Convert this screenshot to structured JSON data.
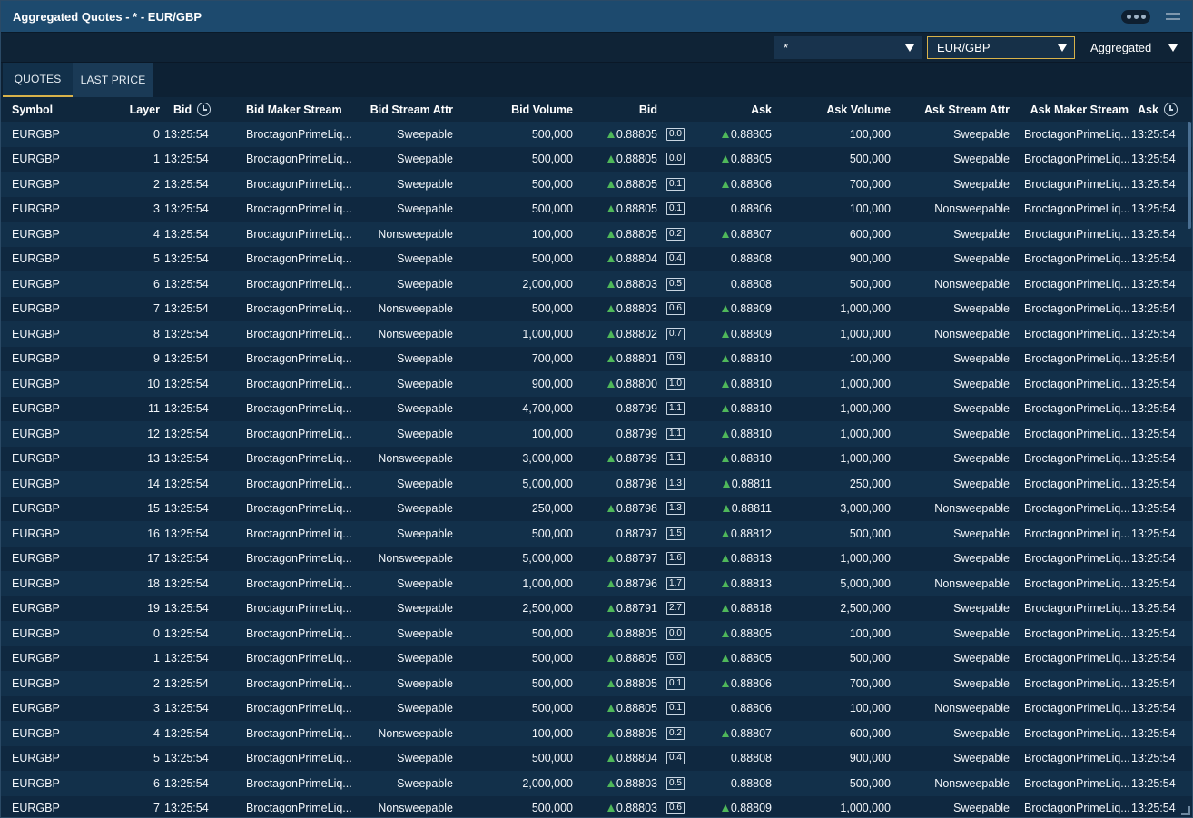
{
  "window": {
    "title": "Aggregated Quotes - * - EUR/GBP",
    "more_icon": "more-dots-icon",
    "menu_icon": "hamburger-icon"
  },
  "toolbar": {
    "filter_value": "*",
    "pair_value": "EUR/GBP",
    "mode_value": "Aggregated",
    "accent_color": "#d8b24a"
  },
  "tabs": [
    {
      "label": "QUOTES",
      "active": true
    },
    {
      "label": "LAST PRICE",
      "active": false
    }
  ],
  "columns": {
    "symbol": "Symbol",
    "layer": "Layer",
    "bid_time": "Bid",
    "bid_maker_stream": "Bid Maker Stream",
    "bid_stream_attr": "Bid Stream Attr",
    "bid_volume": "Bid Volume",
    "bid": "Bid",
    "ask": "Ask",
    "ask_volume": "Ask Volume",
    "ask_stream_attr": "Ask Stream Attr",
    "ask_maker_stream": "Ask Maker Stream",
    "ask_time": "Ask"
  },
  "up_color": "#4fb85a",
  "rows": [
    {
      "sym": "EURGBP",
      "layer": "0",
      "bt": "13:25:54",
      "bms": "BroctagonPrimeLiq...",
      "bsa": "Sweepable",
      "bvol": "500,000",
      "bid": "0.88805",
      "bup": true,
      "spr": "0.0",
      "ask": "0.88805",
      "aup": true,
      "avol": "100,000",
      "asa": "Sweepable",
      "ams": "BroctagonPrimeLiq...",
      "at": "13:25:54"
    },
    {
      "sym": "EURGBP",
      "layer": "1",
      "bt": "13:25:54",
      "bms": "BroctagonPrimeLiq...",
      "bsa": "Sweepable",
      "bvol": "500,000",
      "bid": "0.88805",
      "bup": true,
      "spr": "0.0",
      "ask": "0.88805",
      "aup": true,
      "avol": "500,000",
      "asa": "Sweepable",
      "ams": "BroctagonPrimeLiq...",
      "at": "13:25:54"
    },
    {
      "sym": "EURGBP",
      "layer": "2",
      "bt": "13:25:54",
      "bms": "BroctagonPrimeLiq...",
      "bsa": "Sweepable",
      "bvol": "500,000",
      "bid": "0.88805",
      "bup": true,
      "spr": "0.1",
      "ask": "0.88806",
      "aup": true,
      "avol": "700,000",
      "asa": "Sweepable",
      "ams": "BroctagonPrimeLiq...",
      "at": "13:25:54"
    },
    {
      "sym": "EURGBP",
      "layer": "3",
      "bt": "13:25:54",
      "bms": "BroctagonPrimeLiq...",
      "bsa": "Sweepable",
      "bvol": "500,000",
      "bid": "0.88805",
      "bup": true,
      "spr": "0.1",
      "ask": "0.88806",
      "aup": false,
      "avol": "100,000",
      "asa": "Nonsweepable",
      "ams": "BroctagonPrimeLiq...",
      "at": "13:25:54"
    },
    {
      "sym": "EURGBP",
      "layer": "4",
      "bt": "13:25:54",
      "bms": "BroctagonPrimeLiq...",
      "bsa": "Nonsweepable",
      "bvol": "100,000",
      "bid": "0.88805",
      "bup": true,
      "spr": "0.2",
      "ask": "0.88807",
      "aup": true,
      "avol": "600,000",
      "asa": "Sweepable",
      "ams": "BroctagonPrimeLiq...",
      "at": "13:25:54"
    },
    {
      "sym": "EURGBP",
      "layer": "5",
      "bt": "13:25:54",
      "bms": "BroctagonPrimeLiq...",
      "bsa": "Sweepable",
      "bvol": "500,000",
      "bid": "0.88804",
      "bup": true,
      "spr": "0.4",
      "ask": "0.88808",
      "aup": false,
      "avol": "900,000",
      "asa": "Sweepable",
      "ams": "BroctagonPrimeLiq...",
      "at": "13:25:54"
    },
    {
      "sym": "EURGBP",
      "layer": "6",
      "bt": "13:25:54",
      "bms": "BroctagonPrimeLiq...",
      "bsa": "Sweepable",
      "bvol": "2,000,000",
      "bid": "0.88803",
      "bup": true,
      "spr": "0.5",
      "ask": "0.88808",
      "aup": false,
      "avol": "500,000",
      "asa": "Nonsweepable",
      "ams": "BroctagonPrimeLiq...",
      "at": "13:25:54"
    },
    {
      "sym": "EURGBP",
      "layer": "7",
      "bt": "13:25:54",
      "bms": "BroctagonPrimeLiq...",
      "bsa": "Nonsweepable",
      "bvol": "500,000",
      "bid": "0.88803",
      "bup": true,
      "spr": "0.6",
      "ask": "0.88809",
      "aup": true,
      "avol": "1,000,000",
      "asa": "Sweepable",
      "ams": "BroctagonPrimeLiq...",
      "at": "13:25:54"
    },
    {
      "sym": "EURGBP",
      "layer": "8",
      "bt": "13:25:54",
      "bms": "BroctagonPrimeLiq...",
      "bsa": "Nonsweepable",
      "bvol": "1,000,000",
      "bid": "0.88802",
      "bup": true,
      "spr": "0.7",
      "ask": "0.88809",
      "aup": true,
      "avol": "1,000,000",
      "asa": "Nonsweepable",
      "ams": "BroctagonPrimeLiq...",
      "at": "13:25:54"
    },
    {
      "sym": "EURGBP",
      "layer": "9",
      "bt": "13:25:54",
      "bms": "BroctagonPrimeLiq...",
      "bsa": "Sweepable",
      "bvol": "700,000",
      "bid": "0.88801",
      "bup": true,
      "spr": "0.9",
      "ask": "0.88810",
      "aup": true,
      "avol": "100,000",
      "asa": "Sweepable",
      "ams": "BroctagonPrimeLiq...",
      "at": "13:25:54"
    },
    {
      "sym": "EURGBP",
      "layer": "10",
      "bt": "13:25:54",
      "bms": "BroctagonPrimeLiq...",
      "bsa": "Sweepable",
      "bvol": "900,000",
      "bid": "0.88800",
      "bup": true,
      "spr": "1.0",
      "ask": "0.88810",
      "aup": true,
      "avol": "1,000,000",
      "asa": "Sweepable",
      "ams": "BroctagonPrimeLiq...",
      "at": "13:25:54"
    },
    {
      "sym": "EURGBP",
      "layer": "11",
      "bt": "13:25:54",
      "bms": "BroctagonPrimeLiq...",
      "bsa": "Sweepable",
      "bvol": "4,700,000",
      "bid": "0.88799",
      "bup": false,
      "spr": "1.1",
      "ask": "0.88810",
      "aup": true,
      "avol": "1,000,000",
      "asa": "Sweepable",
      "ams": "BroctagonPrimeLiq...",
      "at": "13:25:54"
    },
    {
      "sym": "EURGBP",
      "layer": "12",
      "bt": "13:25:54",
      "bms": "BroctagonPrimeLiq...",
      "bsa": "Sweepable",
      "bvol": "100,000",
      "bid": "0.88799",
      "bup": false,
      "spr": "1.1",
      "ask": "0.88810",
      "aup": true,
      "avol": "1,000,000",
      "asa": "Sweepable",
      "ams": "BroctagonPrimeLiq...",
      "at": "13:25:54"
    },
    {
      "sym": "EURGBP",
      "layer": "13",
      "bt": "13:25:54",
      "bms": "BroctagonPrimeLiq...",
      "bsa": "Nonsweepable",
      "bvol": "3,000,000",
      "bid": "0.88799",
      "bup": true,
      "spr": "1.1",
      "ask": "0.88810",
      "aup": true,
      "avol": "1,000,000",
      "asa": "Sweepable",
      "ams": "BroctagonPrimeLiq...",
      "at": "13:25:54"
    },
    {
      "sym": "EURGBP",
      "layer": "14",
      "bt": "13:25:54",
      "bms": "BroctagonPrimeLiq...",
      "bsa": "Sweepable",
      "bvol": "5,000,000",
      "bid": "0.88798",
      "bup": false,
      "spr": "1.3",
      "ask": "0.88811",
      "aup": true,
      "avol": "250,000",
      "asa": "Sweepable",
      "ams": "BroctagonPrimeLiq...",
      "at": "13:25:54"
    },
    {
      "sym": "EURGBP",
      "layer": "15",
      "bt": "13:25:54",
      "bms": "BroctagonPrimeLiq...",
      "bsa": "Sweepable",
      "bvol": "250,000",
      "bid": "0.88798",
      "bup": true,
      "spr": "1.3",
      "ask": "0.88811",
      "aup": true,
      "avol": "3,000,000",
      "asa": "Nonsweepable",
      "ams": "BroctagonPrimeLiq...",
      "at": "13:25:54"
    },
    {
      "sym": "EURGBP",
      "layer": "16",
      "bt": "13:25:54",
      "bms": "BroctagonPrimeLiq...",
      "bsa": "Sweepable",
      "bvol": "500,000",
      "bid": "0.88797",
      "bup": false,
      "spr": "1.5",
      "ask": "0.88812",
      "aup": true,
      "avol": "500,000",
      "asa": "Sweepable",
      "ams": "BroctagonPrimeLiq...",
      "at": "13:25:54"
    },
    {
      "sym": "EURGBP",
      "layer": "17",
      "bt": "13:25:54",
      "bms": "BroctagonPrimeLiq...",
      "bsa": "Nonsweepable",
      "bvol": "5,000,000",
      "bid": "0.88797",
      "bup": true,
      "spr": "1.6",
      "ask": "0.88813",
      "aup": true,
      "avol": "1,000,000",
      "asa": "Sweepable",
      "ams": "BroctagonPrimeLiq...",
      "at": "13:25:54"
    },
    {
      "sym": "EURGBP",
      "layer": "18",
      "bt": "13:25:54",
      "bms": "BroctagonPrimeLiq...",
      "bsa": "Sweepable",
      "bvol": "1,000,000",
      "bid": "0.88796",
      "bup": true,
      "spr": "1.7",
      "ask": "0.88813",
      "aup": true,
      "avol": "5,000,000",
      "asa": "Nonsweepable",
      "ams": "BroctagonPrimeLiq...",
      "at": "13:25:54"
    },
    {
      "sym": "EURGBP",
      "layer": "19",
      "bt": "13:25:54",
      "bms": "BroctagonPrimeLiq...",
      "bsa": "Sweepable",
      "bvol": "2,500,000",
      "bid": "0.88791",
      "bup": true,
      "spr": "2.7",
      "ask": "0.88818",
      "aup": true,
      "avol": "2,500,000",
      "asa": "Sweepable",
      "ams": "BroctagonPrimeLiq...",
      "at": "13:25:54"
    },
    {
      "sym": "EURGBP",
      "layer": "0",
      "bt": "13:25:54",
      "bms": "BroctagonPrimeLiq...",
      "bsa": "Sweepable",
      "bvol": "500,000",
      "bid": "0.88805",
      "bup": true,
      "spr": "0.0",
      "ask": "0.88805",
      "aup": true,
      "avol": "100,000",
      "asa": "Sweepable",
      "ams": "BroctagonPrimeLiq...",
      "at": "13:25:54"
    },
    {
      "sym": "EURGBP",
      "layer": "1",
      "bt": "13:25:54",
      "bms": "BroctagonPrimeLiq...",
      "bsa": "Sweepable",
      "bvol": "500,000",
      "bid": "0.88805",
      "bup": true,
      "spr": "0.0",
      "ask": "0.88805",
      "aup": true,
      "avol": "500,000",
      "asa": "Sweepable",
      "ams": "BroctagonPrimeLiq...",
      "at": "13:25:54"
    },
    {
      "sym": "EURGBP",
      "layer": "2",
      "bt": "13:25:54",
      "bms": "BroctagonPrimeLiq...",
      "bsa": "Sweepable",
      "bvol": "500,000",
      "bid": "0.88805",
      "bup": true,
      "spr": "0.1",
      "ask": "0.88806",
      "aup": true,
      "avol": "700,000",
      "asa": "Sweepable",
      "ams": "BroctagonPrimeLiq...",
      "at": "13:25:54"
    },
    {
      "sym": "EURGBP",
      "layer": "3",
      "bt": "13:25:54",
      "bms": "BroctagonPrimeLiq...",
      "bsa": "Sweepable",
      "bvol": "500,000",
      "bid": "0.88805",
      "bup": true,
      "spr": "0.1",
      "ask": "0.88806",
      "aup": false,
      "avol": "100,000",
      "asa": "Nonsweepable",
      "ams": "BroctagonPrimeLiq...",
      "at": "13:25:54"
    },
    {
      "sym": "EURGBP",
      "layer": "4",
      "bt": "13:25:54",
      "bms": "BroctagonPrimeLiq...",
      "bsa": "Nonsweepable",
      "bvol": "100,000",
      "bid": "0.88805",
      "bup": true,
      "spr": "0.2",
      "ask": "0.88807",
      "aup": true,
      "avol": "600,000",
      "asa": "Sweepable",
      "ams": "BroctagonPrimeLiq...",
      "at": "13:25:54"
    },
    {
      "sym": "EURGBP",
      "layer": "5",
      "bt": "13:25:54",
      "bms": "BroctagonPrimeLiq...",
      "bsa": "Sweepable",
      "bvol": "500,000",
      "bid": "0.88804",
      "bup": true,
      "spr": "0.4",
      "ask": "0.88808",
      "aup": false,
      "avol": "900,000",
      "asa": "Sweepable",
      "ams": "BroctagonPrimeLiq...",
      "at": "13:25:54"
    },
    {
      "sym": "EURGBP",
      "layer": "6",
      "bt": "13:25:54",
      "bms": "BroctagonPrimeLiq...",
      "bsa": "Sweepable",
      "bvol": "2,000,000",
      "bid": "0.88803",
      "bup": true,
      "spr": "0.5",
      "ask": "0.88808",
      "aup": false,
      "avol": "500,000",
      "asa": "Nonsweepable",
      "ams": "BroctagonPrimeLiq...",
      "at": "13:25:54"
    },
    {
      "sym": "EURGBP",
      "layer": "7",
      "bt": "13:25:54",
      "bms": "BroctagonPrimeLiq...",
      "bsa": "Nonsweepable",
      "bvol": "500,000",
      "bid": "0.88803",
      "bup": true,
      "spr": "0.6",
      "ask": "0.88809",
      "aup": true,
      "avol": "1,000,000",
      "asa": "Sweepable",
      "ams": "BroctagonPrimeLiq...",
      "at": "13:25:54"
    }
  ]
}
